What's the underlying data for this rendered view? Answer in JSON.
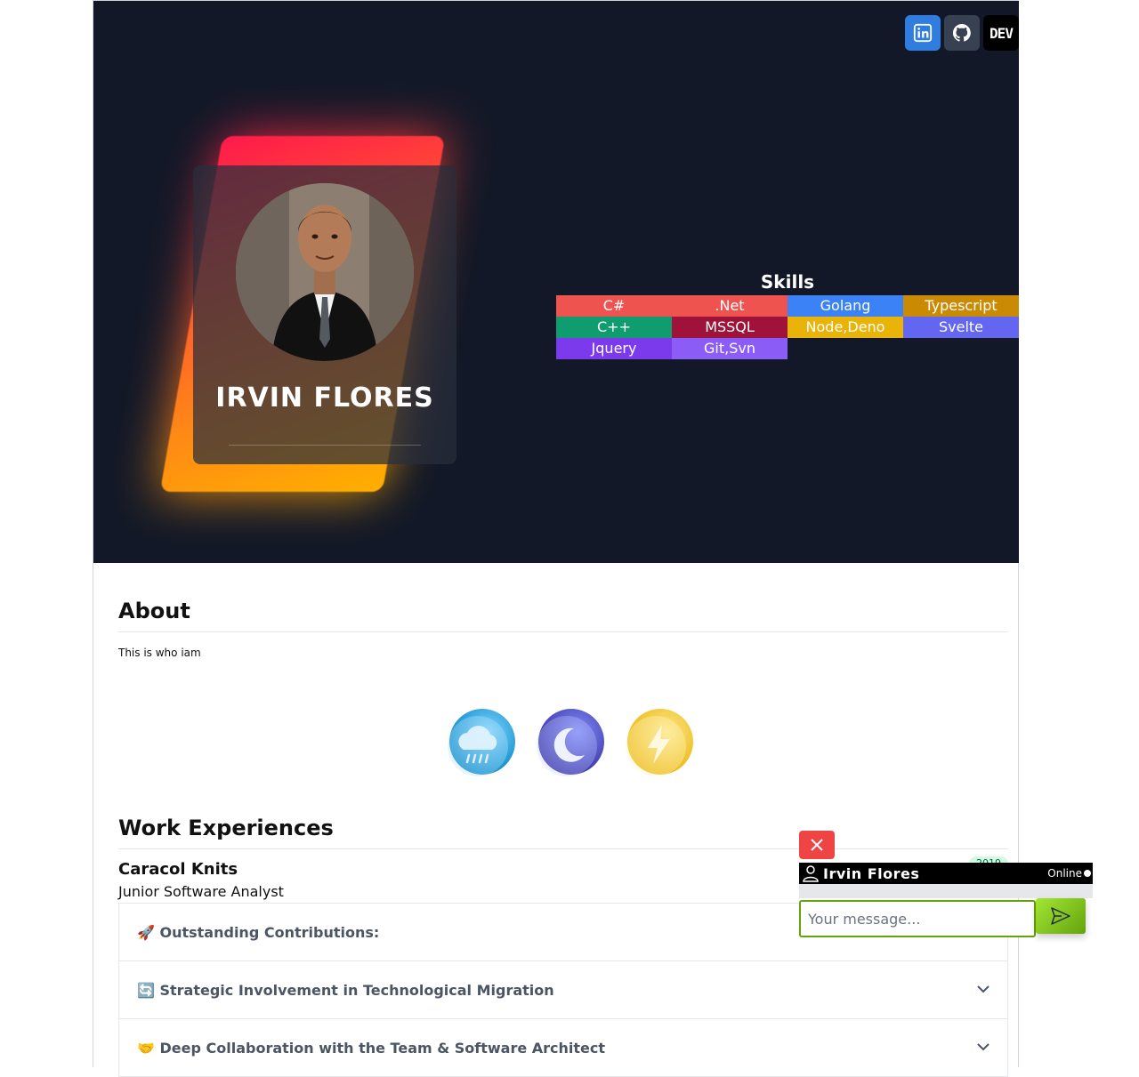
{
  "social": {
    "linkedin_icon": "linkedin-icon",
    "github_icon": "github-icon",
    "dev_label": "DEV"
  },
  "profile": {
    "name": "IRVIN FLORES"
  },
  "skills": {
    "title": "Skills",
    "items": [
      {
        "label": "C#",
        "color": "#ef5350"
      },
      {
        "label": ".Net",
        "color": "#ef5350"
      },
      {
        "label": "Golang",
        "color": "#3b82f6"
      },
      {
        "label": "Typescript",
        "color": "#ca8a04"
      },
      {
        "label": "C++",
        "color": "#0f9d6f"
      },
      {
        "label": "MSSQL",
        "color": "#9f1239"
      },
      {
        "label": "Node,Deno",
        "color": "#eab308"
      },
      {
        "label": "Svelte",
        "color": "#6366f1"
      },
      {
        "label": "Jquery",
        "color": "#7c3aed"
      },
      {
        "label": "Git,Svn",
        "color": "#8b5cf6"
      }
    ]
  },
  "about": {
    "heading": "About",
    "text": "This is who iam"
  },
  "work": {
    "heading": "Work Experiences",
    "company": "Caracol Knits",
    "role": "Junior Software Analyst",
    "year": "2019",
    "accordion": [
      "🚀 Outstanding Contributions:",
      "🔄 Strategic Involvement in Technological Migration",
      "🤝 Deep Collaboration with the Team & Software Architect"
    ]
  },
  "chat": {
    "name": "Irvin Flores",
    "status": "Online",
    "placeholder": "Your message..."
  }
}
